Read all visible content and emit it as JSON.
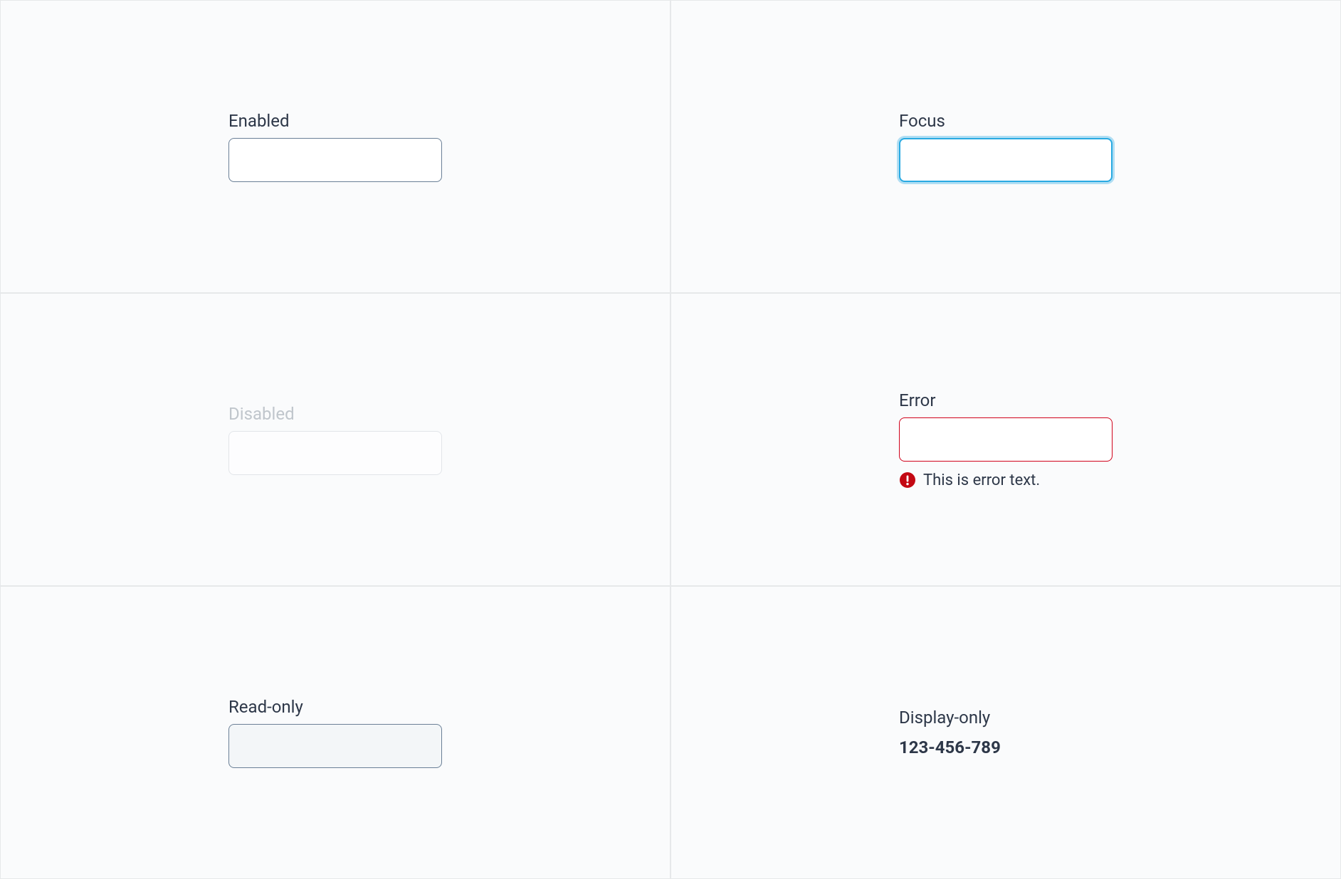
{
  "states": {
    "enabled": {
      "label": "Enabled",
      "value": ""
    },
    "focus": {
      "label": "Focus",
      "value": ""
    },
    "disabled": {
      "label": "Disabled",
      "value": ""
    },
    "error": {
      "label": "Error",
      "value": "",
      "message": "This is error text."
    },
    "readonly": {
      "label": "Read-only",
      "value": ""
    },
    "display": {
      "label": "Display-only",
      "value": "123-456-789"
    }
  },
  "colors": {
    "panel_bg": "#fafbfc",
    "panel_border": "#e6e8ea",
    "text": "#2d3748",
    "disabled_text": "#c0c6cc",
    "input_border": "#6a7f96",
    "focus_border": "#29aae2",
    "error_border": "#d0021b",
    "error_icon": "#c30813"
  }
}
